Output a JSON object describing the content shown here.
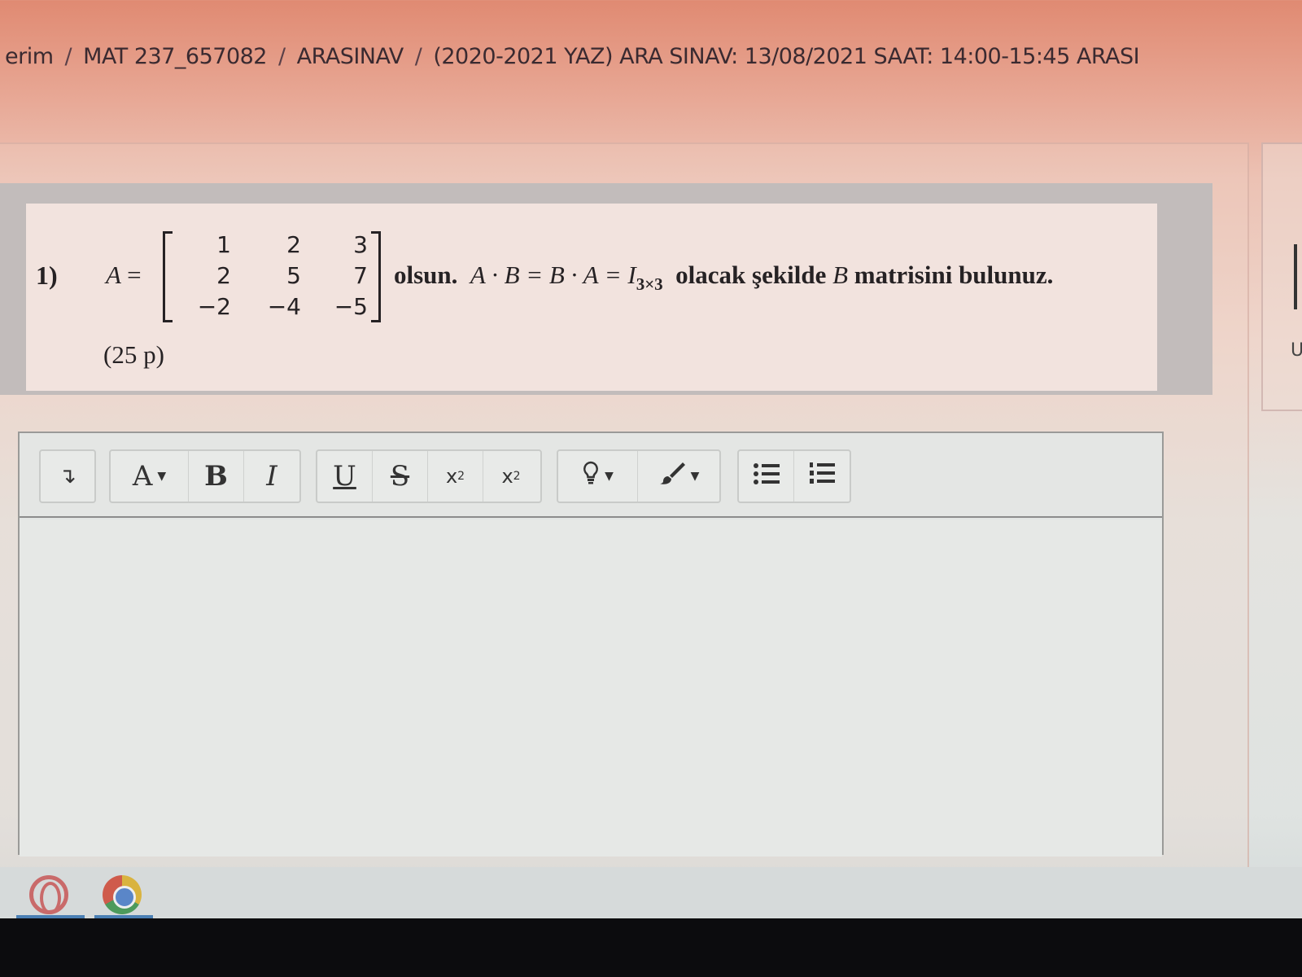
{
  "breadcrumb": [
    "erim",
    "MAT 237_657082",
    "ARASINAV",
    "(2020-2021 YAZ) ARA SINAV: 13/08/2021 SAAT: 14:00-15:45 ARASI"
  ],
  "breadcrumb_separator": "/",
  "question": {
    "number": "1)",
    "matrix_name": "A",
    "equals": "=",
    "matrix": [
      [
        "1",
        "2",
        "3"
      ],
      [
        "2",
        "5",
        "7"
      ],
      [
        "−2",
        "−4",
        "−5"
      ]
    ],
    "text_olsun": "olsun.",
    "eq_A": "A",
    "eq_dot1": " · ",
    "eq_B": "B",
    "eq_eq1": " = ",
    "eq_B2": "B",
    "eq_dot2": " · ",
    "eq_A2": "A",
    "eq_eq2": " = ",
    "eq_I": "I",
    "eq_sub": "3×3",
    "text_olacak": "olacak şekilde",
    "text_B": "B",
    "text_find": "matrisini bulunuz.",
    "points": "(25 p)"
  },
  "toolbar": {
    "expand": "↴",
    "font": "A",
    "bold": "B",
    "italic": "I",
    "underline": "U",
    "strike": "S",
    "subscript_base": "x",
    "subscript_mark": "2",
    "superscript_base": "x",
    "superscript_mark": "2"
  },
  "right_panel_letter": "U",
  "taskbar_apps": [
    "opera-icon",
    "chrome-icon"
  ]
}
